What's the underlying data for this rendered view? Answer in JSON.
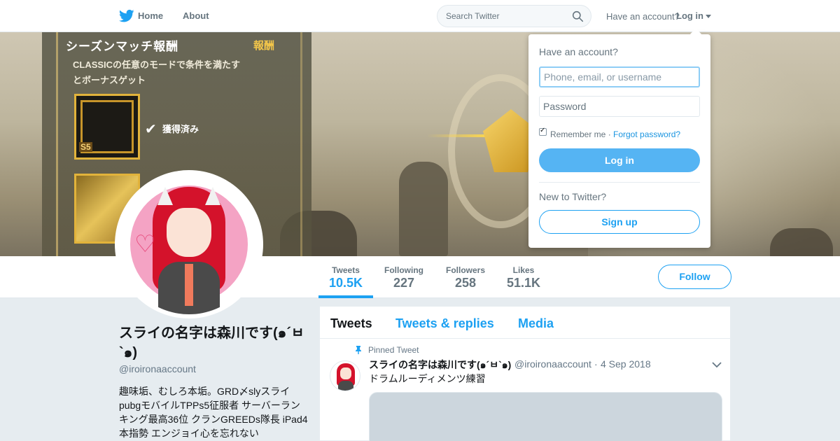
{
  "nav": {
    "home_label": "Home",
    "about_label": "About",
    "search_placeholder": "Search Twitter",
    "have_account": "Have an account?",
    "login_label": "Log in"
  },
  "banner": {
    "title": "シーズンマッチ報酬",
    "reward_label": "報酬",
    "desc_line1": "CLASSICの任意のモードで条件を満たす",
    "desc_line2": "とボーナスゲット",
    "item_badge": "S5",
    "acquired_label": "獲得済み"
  },
  "profile": {
    "name": "スライの名字は森川です(๑´ㅂ`๑)",
    "handle": "@iroironaaccount",
    "bio": "趣味垢、むしろ本垢。GRD〆slyスライ pubgモバイルTPPs5征服者 サーバーランキング最高36位 クランGREEDs隊長 iPad4本指勢 エンジョイ心を忘れない"
  },
  "stats": [
    {
      "label": "Tweets",
      "value": "10.5K"
    },
    {
      "label": "Following",
      "value": "227"
    },
    {
      "label": "Followers",
      "value": "258"
    },
    {
      "label": "Likes",
      "value": "51.1K"
    }
  ],
  "follow_label": "Follow",
  "timeline": {
    "tabs": [
      "Tweets",
      "Tweets & replies",
      "Media"
    ],
    "pinned_label": "Pinned Tweet",
    "tweet": {
      "name": "スライの名字は森川です(๑´ㅂ`๑)",
      "handle": "@iroironaaccount",
      "separator": "·",
      "date": "4 Sep 2018",
      "text": "ドラムルーディメンツ練習"
    }
  },
  "login_dropdown": {
    "heading": "Have an account?",
    "username_placeholder": "Phone, email, or username",
    "password_placeholder": "Password",
    "remember_label": "Remember me ·",
    "forgot_label": "Forgot password?",
    "login_button": "Log in",
    "new_heading": "New to Twitter?",
    "signup_button": "Sign up"
  },
  "colors": {
    "brand_blue": "#1da1f2",
    "login_button": "#55b4f3",
    "page_background": "#e6ecf0",
    "avatar_pink": "#f4a3c4",
    "hair_red": "#d4122b"
  },
  "icons": {
    "logo": "twitter-bird-icon",
    "search": "search-icon",
    "caret": "caret-down-icon",
    "pin": "pin-icon",
    "tweet_menu": "chevron-down-icon",
    "check": "checkmark-icon"
  }
}
